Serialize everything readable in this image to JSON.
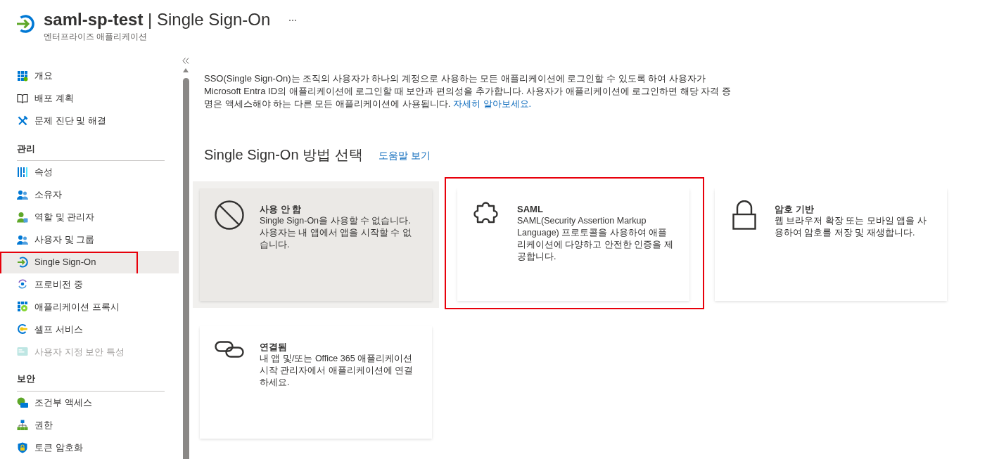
{
  "header": {
    "title": "**saml-sp-test** | Single Sign-On",
    "subtitle": "엔터프라이즈 애플리케이션"
  },
  "sidebar": {
    "sections": [
      {
        "items": [
          {
            "label": "개요",
            "kind": "overview",
            "selected": false,
            "disabled": false,
            "highlighted": false
          },
          {
            "label": "배포 계획",
            "kind": "plan",
            "selected": false,
            "disabled": false,
            "highlighted": false
          },
          {
            "label": "문제 진단 및 해결",
            "kind": "troubleshoot",
            "selected": false,
            "disabled": false,
            "highlighted": false
          }
        ]
      },
      {
        "heading": "관리",
        "items": [
          {
            "label": "속성",
            "kind": "properties",
            "selected": false,
            "disabled": false,
            "highlighted": false
          },
          {
            "label": "소유자",
            "kind": "owners",
            "selected": false,
            "disabled": false,
            "highlighted": false
          },
          {
            "label": "역할 및 관리자",
            "kind": "roles",
            "selected": false,
            "disabled": false,
            "highlighted": false
          },
          {
            "label": "사용자 및 그룹",
            "kind": "users",
            "selected": false,
            "disabled": false,
            "highlighted": false
          },
          {
            "label": "Single Sign-On",
            "kind": "sso",
            "selected": true,
            "disabled": false,
            "highlighted": true
          },
          {
            "label": "프로비전 중",
            "kind": "provisioning",
            "selected": false,
            "disabled": false,
            "highlighted": false
          },
          {
            "label": "애플리케이션 프록시",
            "kind": "proxy",
            "selected": false,
            "disabled": false,
            "highlighted": false
          },
          {
            "label": "셀프 서비스",
            "kind": "selfservice",
            "selected": false,
            "disabled": false,
            "highlighted": false
          },
          {
            "label": "사용자 지정 보안 특성",
            "kind": "attributes",
            "selected": false,
            "disabled": true,
            "highlighted": false
          }
        ]
      },
      {
        "heading": "보안",
        "items": [
          {
            "label": "조건부 액세스",
            "kind": "conditional",
            "selected": false,
            "disabled": false,
            "highlighted": false
          },
          {
            "label": "권한",
            "kind": "permissions",
            "selected": false,
            "disabled": false,
            "highlighted": false
          },
          {
            "label": "토큰 암호화",
            "kind": "token",
            "selected": false,
            "disabled": false,
            "highlighted": false
          }
        ]
      }
    ]
  },
  "intro": {
    "text": "SSO(Single Sign-On)는 조직의 사용자가 하나의 계정으로 사용하는 모든 애플리케이션에 로그인할 수 있도록 하여 사용자가 Microsoft Entra ID의 애플리케이션에 로그인할 때 보안과 편의성을 추가합니다. 사용자가 애플리케이션에 로그인하면 해당 자격 증명은 액세스해야 하는 다른 모든 애플리케이션에 사용됩니다.",
    "link": "자세히 알아보세요."
  },
  "methods": {
    "heading": "Single Sign-On 방법 선택",
    "help_link": "도움말 보기",
    "cards": [
      {
        "kind": "disabled",
        "title": "사용 안 함",
        "description": "Single Sign-On을 사용할 수 없습니다. 사용자는 내 앱에서 앱을 시작할 수 없습니다.",
        "selected": true,
        "highlighted": false
      },
      {
        "kind": "saml",
        "title": "SAML",
        "description": "SAML(Security Assertion Markup Language) 프로토콜을 사용하여 애플리케이션에 다양하고 안전한 인증을 제공합니다.",
        "selected": false,
        "highlighted": true
      },
      {
        "kind": "password",
        "title": "암호 기반",
        "description": "웹 브라우저 확장 또는 모바일 앱을 사용하여 암호를 저장 및 재생합니다.",
        "selected": false,
        "highlighted": false
      },
      {
        "kind": "linked",
        "title": "연결됨",
        "description": "내 앱 및/또는 Office 365 애플리케이션 시작 관리자에서 애플리케이션에 연결하세요.",
        "selected": false,
        "highlighted": false
      }
    ]
  }
}
